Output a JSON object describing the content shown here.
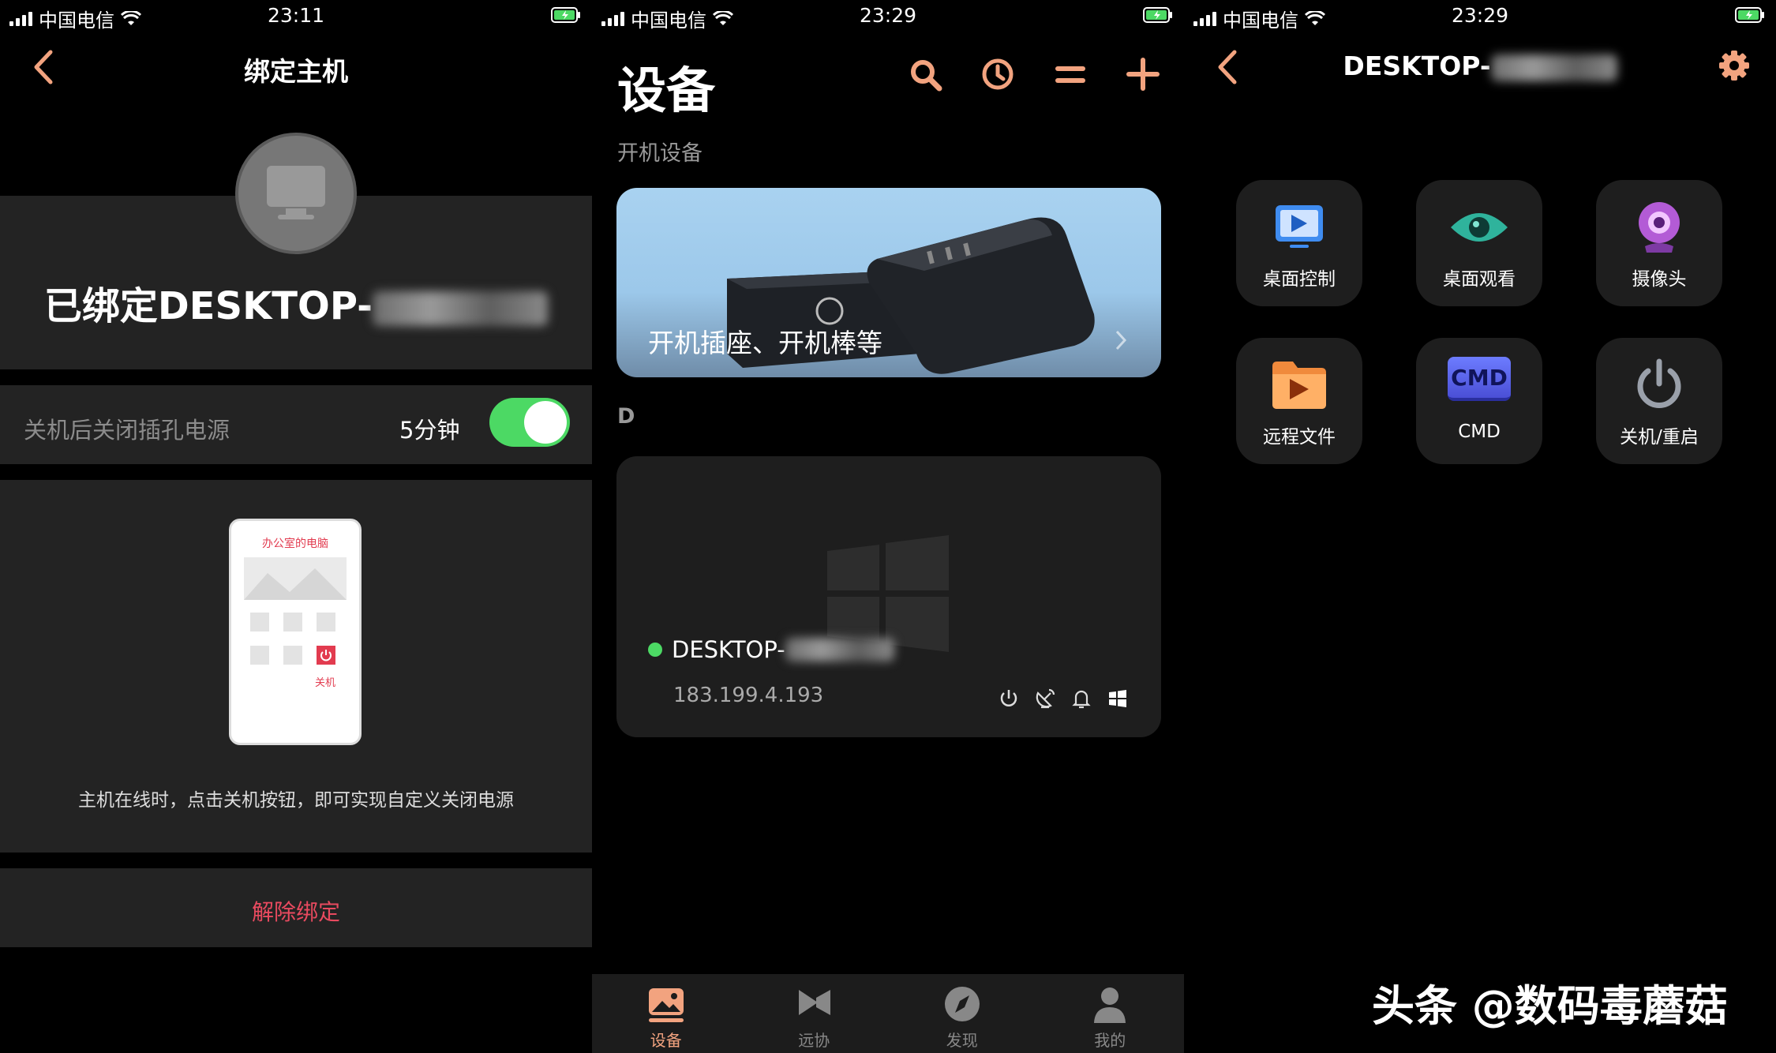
{
  "screen1": {
    "status": {
      "carrier": "中国电信",
      "time": "23:11"
    },
    "title": "绑定主机",
    "bound_prefix": "已绑定DESKTOP-",
    "setting_label": "关机后关闭插孔电源",
    "setting_value": "5分钟",
    "toggle_on": true,
    "illustration": {
      "title": "办公室的电脑",
      "shutdown_label": "关机"
    },
    "hint": "主机在线时，点击关机按钮，即可实现自定义关闭电源",
    "unbind_label": "解除绑定"
  },
  "screen2": {
    "status": {
      "carrier": "中国电信",
      "time": "23:29"
    },
    "title": "设备",
    "section_power": "开机设备",
    "banner_text": "开机插座、开机棒等",
    "section_d": "D",
    "device": {
      "name_prefix": "DESKTOP-",
      "ip": "183.199.4.193",
      "online": true
    },
    "tabs": [
      {
        "label": "设备",
        "icon": "devices-icon",
        "active": true
      },
      {
        "label": "远协",
        "icon": "remote-icon",
        "active": false
      },
      {
        "label": "发现",
        "icon": "compass-icon",
        "active": false
      },
      {
        "label": "我的",
        "icon": "profile-icon",
        "active": false
      }
    ]
  },
  "screen3": {
    "status": {
      "carrier": "中国电信",
      "time": "23:29"
    },
    "title_prefix": "DESKTOP-",
    "tiles": [
      {
        "label": "桌面控制",
        "icon": "desktop-control-icon"
      },
      {
        "label": "桌面观看",
        "icon": "eye-icon"
      },
      {
        "label": "摄像头",
        "icon": "camera-icon"
      },
      {
        "label": "远程文件",
        "icon": "folder-icon"
      },
      {
        "label": "CMD",
        "icon": "cmd-icon"
      },
      {
        "label": "关机/重启",
        "icon": "power-icon"
      }
    ],
    "cmd_icon_text": "CMD"
  },
  "watermark": "头条 @数码毒蘑菇",
  "colors": {
    "accent": "#f2a37f",
    "online": "#4cd964",
    "danger": "#e84a5f",
    "card": "#232323"
  }
}
